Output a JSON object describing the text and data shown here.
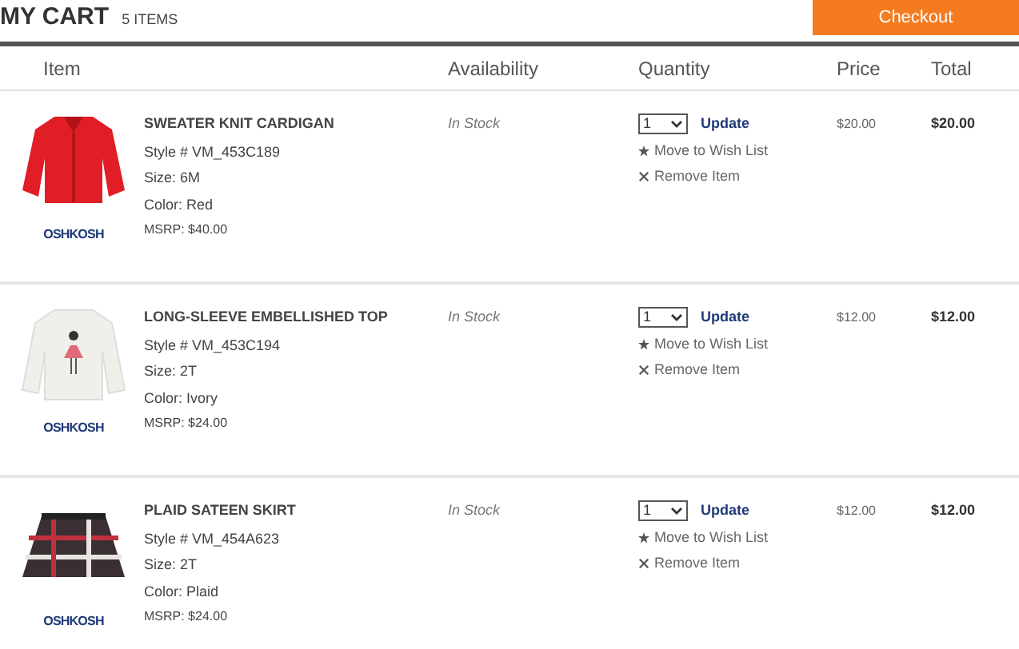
{
  "header": {
    "title": "MY CART",
    "count": "5 ITEMS",
    "checkout_button": "Checkout"
  },
  "table": {
    "columns": [
      "Item",
      "Availability",
      "Quantity",
      "Price",
      "Total"
    ],
    "rows": [
      {
        "name": "SWEATER KNIT CARDIGAN",
        "style": "Style # VM_453C189",
        "size": "Size: 6M",
        "color_label": "Color: Red",
        "msrp": "MSRP: $40.00",
        "brand": "OSHKOSH",
        "availability": "In Stock",
        "quantity": "1",
        "update": "Update",
        "wish": "Move to Wish List",
        "remove": "Remove Item",
        "price": "$20.00",
        "total": "$20.00"
      },
      {
        "name": "LONG-SLEEVE EMBELLISHED TOP",
        "style": "Style # VM_453C194",
        "size": "Size: 2T",
        "color_label": "Color: Ivory",
        "msrp": "MSRP: $24.00",
        "brand": "OSHKOSH",
        "availability": "In Stock",
        "quantity": "1",
        "update": "Update",
        "wish": "Move to Wish List",
        "remove": "Remove Item",
        "price": "$12.00",
        "total": "$12.00"
      },
      {
        "name": "PLAID SATEEN SKIRT",
        "style": "Style # VM_454A623",
        "size": "Size: 2T",
        "color_label": "Color: Plaid",
        "msrp": "MSRP: $24.00",
        "brand": "OSHKOSH",
        "availability": "In Stock",
        "quantity": "1",
        "update": "Update",
        "wish": "Move to Wish List",
        "remove": "Remove Item",
        "price": "$12.00",
        "total": "$12.00"
      }
    ]
  }
}
